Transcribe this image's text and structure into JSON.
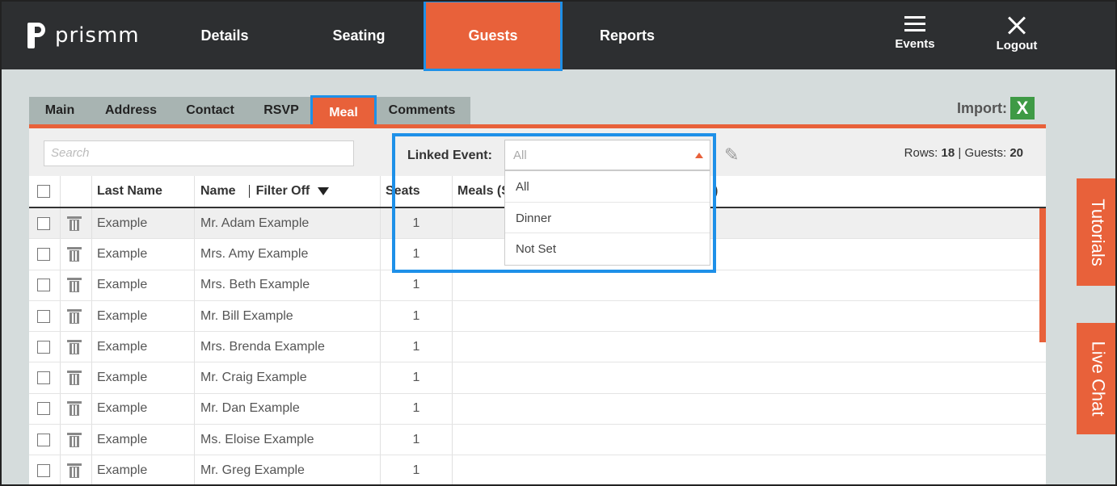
{
  "brand": {
    "name": "prismm"
  },
  "nav": {
    "tabs": [
      {
        "label": "Details"
      },
      {
        "label": "Seating"
      },
      {
        "label": "Guests"
      },
      {
        "label": "Reports"
      }
    ],
    "events_label": "Events",
    "logout_label": "Logout"
  },
  "subtabs": [
    {
      "label": "Main"
    },
    {
      "label": "Address"
    },
    {
      "label": "Contact"
    },
    {
      "label": "RSVP"
    },
    {
      "label": "Meal"
    },
    {
      "label": "Comments"
    }
  ],
  "import_label": "Import:",
  "import_icon": "X",
  "toolbar": {
    "search_placeholder": "Search",
    "linked_event_label": "Linked Event:",
    "linked_event_value": "All",
    "rows_label": "Rows:",
    "rows_count": "18",
    "separator": "|",
    "guests_label": "Guests:",
    "guests_count": "20"
  },
  "dropdown": {
    "options": [
      "All",
      "Dinner",
      "Not Set"
    ]
  },
  "grid": {
    "headers": {
      "last_name": "Last Name",
      "name": "Name",
      "filter": "Filter Off",
      "seats": "Seats",
      "meals": "Meals (S",
      "meals_tail": ")"
    },
    "rows": [
      {
        "last": "Example",
        "name": "Mr. Adam Example",
        "seats": "1"
      },
      {
        "last": "Example",
        "name": "Mrs. Amy Example",
        "seats": "1"
      },
      {
        "last": "Example",
        "name": "Mrs. Beth Example",
        "seats": "1"
      },
      {
        "last": "Example",
        "name": "Mr. Bill Example",
        "seats": "1"
      },
      {
        "last": "Example",
        "name": "Mrs. Brenda Example",
        "seats": "1"
      },
      {
        "last": "Example",
        "name": "Mr. Craig Example",
        "seats": "1"
      },
      {
        "last": "Example",
        "name": "Mr. Dan Example",
        "seats": "1"
      },
      {
        "last": "Example",
        "name": "Ms. Eloise Example",
        "seats": "1"
      },
      {
        "last": "Example",
        "name": "Mr. Greg Example",
        "seats": "1"
      }
    ]
  },
  "side": {
    "tutorials": "Tutorials",
    "live_chat": "Live Chat"
  },
  "colors": {
    "accent": "#e8613a",
    "nav_bg": "#2d2f31",
    "highlight": "#1e90e8",
    "excel": "#3e9a45"
  }
}
